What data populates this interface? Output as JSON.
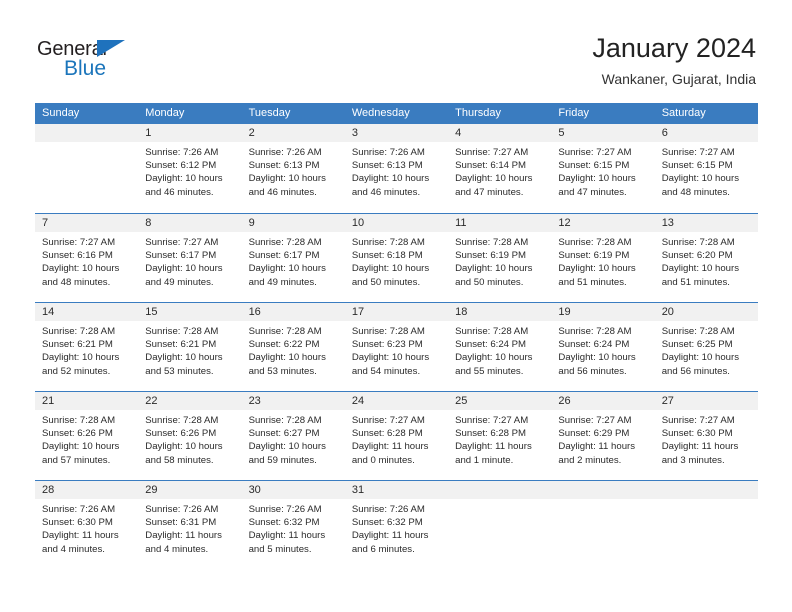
{
  "logo": {
    "word_top": "General",
    "word_bottom": "Blue",
    "triangle_color": "#1f72bd",
    "blue_color": "#1b75bb"
  },
  "header": {
    "title": "January 2024",
    "subtitle": "Wankaner, Gujarat, India"
  },
  "theme": {
    "header_blue": "#3a7cc0",
    "date_band": "#f1f1f1",
    "text": "#2b2b2b"
  },
  "weekday_headers": [
    "Sunday",
    "Monday",
    "Tuesday",
    "Wednesday",
    "Thursday",
    "Friday",
    "Saturday"
  ],
  "weeks": [
    [
      {
        "day": "",
        "sunrise": "",
        "sunset": "",
        "daylight_line1": "",
        "daylight_line2": ""
      },
      {
        "day": "1",
        "sunrise": "Sunrise: 7:26 AM",
        "sunset": "Sunset: 6:12 PM",
        "daylight_line1": "Daylight: 10 hours",
        "daylight_line2": "and 46 minutes."
      },
      {
        "day": "2",
        "sunrise": "Sunrise: 7:26 AM",
        "sunset": "Sunset: 6:13 PM",
        "daylight_line1": "Daylight: 10 hours",
        "daylight_line2": "and 46 minutes."
      },
      {
        "day": "3",
        "sunrise": "Sunrise: 7:26 AM",
        "sunset": "Sunset: 6:13 PM",
        "daylight_line1": "Daylight: 10 hours",
        "daylight_line2": "and 46 minutes."
      },
      {
        "day": "4",
        "sunrise": "Sunrise: 7:27 AM",
        "sunset": "Sunset: 6:14 PM",
        "daylight_line1": "Daylight: 10 hours",
        "daylight_line2": "and 47 minutes."
      },
      {
        "day": "5",
        "sunrise": "Sunrise: 7:27 AM",
        "sunset": "Sunset: 6:15 PM",
        "daylight_line1": "Daylight: 10 hours",
        "daylight_line2": "and 47 minutes."
      },
      {
        "day": "6",
        "sunrise": "Sunrise: 7:27 AM",
        "sunset": "Sunset: 6:15 PM",
        "daylight_line1": "Daylight: 10 hours",
        "daylight_line2": "and 48 minutes."
      }
    ],
    [
      {
        "day": "7",
        "sunrise": "Sunrise: 7:27 AM",
        "sunset": "Sunset: 6:16 PM",
        "daylight_line1": "Daylight: 10 hours",
        "daylight_line2": "and 48 minutes."
      },
      {
        "day": "8",
        "sunrise": "Sunrise: 7:27 AM",
        "sunset": "Sunset: 6:17 PM",
        "daylight_line1": "Daylight: 10 hours",
        "daylight_line2": "and 49 minutes."
      },
      {
        "day": "9",
        "sunrise": "Sunrise: 7:28 AM",
        "sunset": "Sunset: 6:17 PM",
        "daylight_line1": "Daylight: 10 hours",
        "daylight_line2": "and 49 minutes."
      },
      {
        "day": "10",
        "sunrise": "Sunrise: 7:28 AM",
        "sunset": "Sunset: 6:18 PM",
        "daylight_line1": "Daylight: 10 hours",
        "daylight_line2": "and 50 minutes."
      },
      {
        "day": "11",
        "sunrise": "Sunrise: 7:28 AM",
        "sunset": "Sunset: 6:19 PM",
        "daylight_line1": "Daylight: 10 hours",
        "daylight_line2": "and 50 minutes."
      },
      {
        "day": "12",
        "sunrise": "Sunrise: 7:28 AM",
        "sunset": "Sunset: 6:19 PM",
        "daylight_line1": "Daylight: 10 hours",
        "daylight_line2": "and 51 minutes."
      },
      {
        "day": "13",
        "sunrise": "Sunrise: 7:28 AM",
        "sunset": "Sunset: 6:20 PM",
        "daylight_line1": "Daylight: 10 hours",
        "daylight_line2": "and 51 minutes."
      }
    ],
    [
      {
        "day": "14",
        "sunrise": "Sunrise: 7:28 AM",
        "sunset": "Sunset: 6:21 PM",
        "daylight_line1": "Daylight: 10 hours",
        "daylight_line2": "and 52 minutes."
      },
      {
        "day": "15",
        "sunrise": "Sunrise: 7:28 AM",
        "sunset": "Sunset: 6:21 PM",
        "daylight_line1": "Daylight: 10 hours",
        "daylight_line2": "and 53 minutes."
      },
      {
        "day": "16",
        "sunrise": "Sunrise: 7:28 AM",
        "sunset": "Sunset: 6:22 PM",
        "daylight_line1": "Daylight: 10 hours",
        "daylight_line2": "and 53 minutes."
      },
      {
        "day": "17",
        "sunrise": "Sunrise: 7:28 AM",
        "sunset": "Sunset: 6:23 PM",
        "daylight_line1": "Daylight: 10 hours",
        "daylight_line2": "and 54 minutes."
      },
      {
        "day": "18",
        "sunrise": "Sunrise: 7:28 AM",
        "sunset": "Sunset: 6:24 PM",
        "daylight_line1": "Daylight: 10 hours",
        "daylight_line2": "and 55 minutes."
      },
      {
        "day": "19",
        "sunrise": "Sunrise: 7:28 AM",
        "sunset": "Sunset: 6:24 PM",
        "daylight_line1": "Daylight: 10 hours",
        "daylight_line2": "and 56 minutes."
      },
      {
        "day": "20",
        "sunrise": "Sunrise: 7:28 AM",
        "sunset": "Sunset: 6:25 PM",
        "daylight_line1": "Daylight: 10 hours",
        "daylight_line2": "and 56 minutes."
      }
    ],
    [
      {
        "day": "21",
        "sunrise": "Sunrise: 7:28 AM",
        "sunset": "Sunset: 6:26 PM",
        "daylight_line1": "Daylight: 10 hours",
        "daylight_line2": "and 57 minutes."
      },
      {
        "day": "22",
        "sunrise": "Sunrise: 7:28 AM",
        "sunset": "Sunset: 6:26 PM",
        "daylight_line1": "Daylight: 10 hours",
        "daylight_line2": "and 58 minutes."
      },
      {
        "day": "23",
        "sunrise": "Sunrise: 7:28 AM",
        "sunset": "Sunset: 6:27 PM",
        "daylight_line1": "Daylight: 10 hours",
        "daylight_line2": "and 59 minutes."
      },
      {
        "day": "24",
        "sunrise": "Sunrise: 7:27 AM",
        "sunset": "Sunset: 6:28 PM",
        "daylight_line1": "Daylight: 11 hours",
        "daylight_line2": "and 0 minutes."
      },
      {
        "day": "25",
        "sunrise": "Sunrise: 7:27 AM",
        "sunset": "Sunset: 6:28 PM",
        "daylight_line1": "Daylight: 11 hours",
        "daylight_line2": "and 1 minute."
      },
      {
        "day": "26",
        "sunrise": "Sunrise: 7:27 AM",
        "sunset": "Sunset: 6:29 PM",
        "daylight_line1": "Daylight: 11 hours",
        "daylight_line2": "and 2 minutes."
      },
      {
        "day": "27",
        "sunrise": "Sunrise: 7:27 AM",
        "sunset": "Sunset: 6:30 PM",
        "daylight_line1": "Daylight: 11 hours",
        "daylight_line2": "and 3 minutes."
      }
    ],
    [
      {
        "day": "28",
        "sunrise": "Sunrise: 7:26 AM",
        "sunset": "Sunset: 6:30 PM",
        "daylight_line1": "Daylight: 11 hours",
        "daylight_line2": "and 4 minutes."
      },
      {
        "day": "29",
        "sunrise": "Sunrise: 7:26 AM",
        "sunset": "Sunset: 6:31 PM",
        "daylight_line1": "Daylight: 11 hours",
        "daylight_line2": "and 4 minutes."
      },
      {
        "day": "30",
        "sunrise": "Sunrise: 7:26 AM",
        "sunset": "Sunset: 6:32 PM",
        "daylight_line1": "Daylight: 11 hours",
        "daylight_line2": "and 5 minutes."
      },
      {
        "day": "31",
        "sunrise": "Sunrise: 7:26 AM",
        "sunset": "Sunset: 6:32 PM",
        "daylight_line1": "Daylight: 11 hours",
        "daylight_line2": "and 6 minutes."
      },
      {
        "day": "",
        "sunrise": "",
        "sunset": "",
        "daylight_line1": "",
        "daylight_line2": ""
      },
      {
        "day": "",
        "sunrise": "",
        "sunset": "",
        "daylight_line1": "",
        "daylight_line2": ""
      },
      {
        "day": "",
        "sunrise": "",
        "sunset": "",
        "daylight_line1": "",
        "daylight_line2": ""
      }
    ]
  ]
}
